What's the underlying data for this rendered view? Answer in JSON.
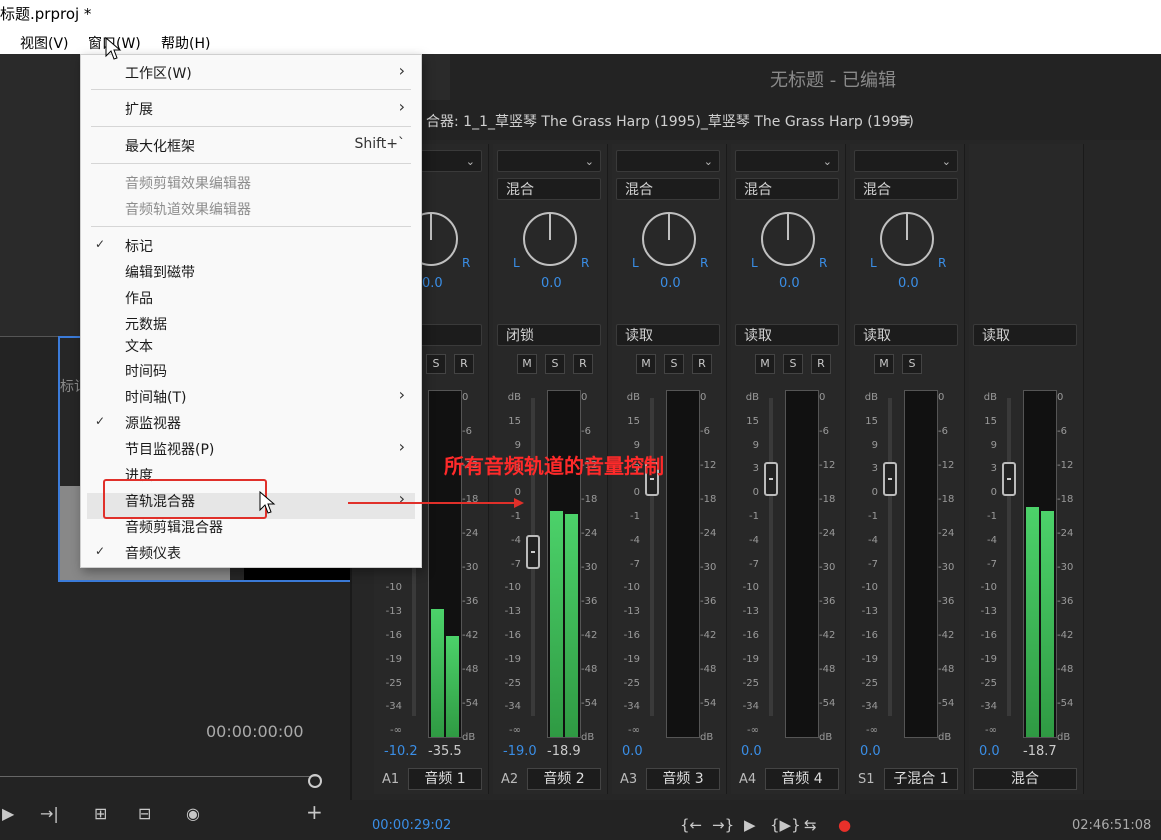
{
  "window": {
    "title": "标题.prproj *"
  },
  "menubar": {
    "items": [
      "视图(V)",
      "窗口(W)",
      "帮助(H)"
    ]
  },
  "panel_title": "无标题 - 已编辑",
  "mixer": {
    "header": "合器: 1_1_草竖琴 The Grass Harp (1995)_草竖琴 The Grass Harp (1995)",
    "menu_icon": "≡",
    "modes": [
      "混合",
      "混合",
      "混合",
      "混合"
    ],
    "automation": [
      "闭锁",
      "读取",
      "读取",
      "读取",
      "读取"
    ],
    "pan_values": [
      "0.0",
      "0.0",
      "0.0",
      "0.0",
      "0.0"
    ],
    "lr": [
      "L",
      "R"
    ],
    "msr": [
      "M",
      "S",
      "R"
    ],
    "scale_left": [
      "dB",
      "15",
      "9",
      "3",
      "0",
      "-1",
      "-4",
      "-7",
      "-10",
      "-13",
      "-16",
      "-19",
      "-25",
      "-34",
      "-∞"
    ],
    "scale_right": [
      "0",
      "-6",
      "-12",
      "-18",
      "-24",
      "-30",
      "-36",
      "-42",
      "-48",
      "-54",
      "dB"
    ],
    "tracks": [
      {
        "id": "A1",
        "name": "音频 1",
        "vol": "-10.2",
        "peak": "-35.5",
        "level_left": 0.38,
        "level_right": 0.3,
        "fader": -10.2
      },
      {
        "id": "A2",
        "name": "音频 2",
        "vol": "-19.0",
        "peak": "-18.9",
        "level_left": 0.67,
        "level_right": 0.66,
        "fader": -19.0
      },
      {
        "id": "A3",
        "name": "音频 3",
        "vol": "0.0",
        "peak": "",
        "level_left": 0,
        "level_right": 0,
        "fader": 0
      },
      {
        "id": "A4",
        "name": "音频 4",
        "vol": "0.0",
        "peak": "",
        "level_left": 0,
        "level_right": 0,
        "fader": 0
      },
      {
        "id": "S1",
        "name": "子混合 1",
        "vol": "0.0",
        "peak": "",
        "level_left": 0,
        "level_right": 0,
        "fader": 0
      },
      {
        "id": "",
        "name": "混合",
        "vol": "0.0",
        "peak": "-18.7",
        "level_left": 0.68,
        "level_right": 0.67,
        "fader": 0
      }
    ],
    "timecode_current": "00:00:29:02",
    "timecode_total": "02:46:51:08"
  },
  "left": {
    "partial_label": "标记",
    "timecode": "00:00:00:00"
  },
  "menu": {
    "items": [
      {
        "label": "工作区(W)",
        "submenu": true
      },
      {
        "label": "扩展",
        "submenu": true
      },
      {
        "label": "最大化框架",
        "shortcut": "Shift+`"
      },
      {
        "label": "音频剪辑效果编辑器",
        "disabled": true
      },
      {
        "label": "音频轨道效果编辑器",
        "disabled": true
      },
      {
        "label": "标记",
        "checked": true
      },
      {
        "label": "编辑到磁带"
      },
      {
        "label": "作品"
      },
      {
        "label": "元数据"
      },
      {
        "label": "文本"
      },
      {
        "label": "时间码"
      },
      {
        "label": "时间轴(T)",
        "submenu": true
      },
      {
        "label": "源监视器",
        "checked": true
      },
      {
        "label": "节目监视器(P)",
        "submenu": true
      },
      {
        "label": "进度"
      },
      {
        "label": "音轨混合器",
        "submenu": true,
        "highlighted": true
      },
      {
        "label": "音频剪辑混合器"
      },
      {
        "label": "音频仪表",
        "checked": true
      }
    ]
  },
  "annotation": "所有音频轨道的音量控制",
  "colors": {
    "accent": "#3a8ee6",
    "annotation": "#ff2a2a",
    "meter": "#3fbe58",
    "record": "#e8302a"
  }
}
